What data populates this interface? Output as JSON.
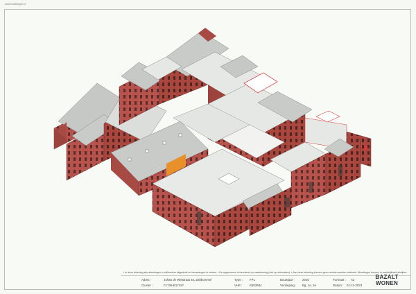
{
  "header": {
    "file_label": "www.bulkfogel.nl"
  },
  "notice": "• In deze tekening zijn afmetingen in millimeters uitgedrukt en benamingen in meters. • De opgenomen is berekend op maatvoering (niet op stukmaten). • Aan deze tekening kunnen geen rechten worden ontleend. Afmetingen kunnen in werkelijkheid afwijken.",
  "titleblock": {
    "adres_label": "Adres :",
    "adres_value": "Johan de Wittstraat 26, Zaltbommel",
    "cluster_label": "Cluster :",
    "cluster_value": "F1726-B17427",
    "type_label": "Type :",
    "type_value": "FPL",
    "vhe_label": "VHE :",
    "vhe_value": "E503934",
    "bouwjaar_label": "Bouwjaar :",
    "bouwjaar_value": "2010",
    "verdieping_label": "Verdieping :",
    "verdieping_value": "Bg, 1e, 2e",
    "formaat_label": "Formaat :",
    "formaat_value": "A3",
    "datum_label": "Datum :",
    "datum_value": "01-11-2023"
  },
  "logo": {
    "line1": "BAZALT",
    "line2": "WONEN"
  },
  "colors": {
    "brick": "#b8524c",
    "brick_dark": "#8e3d39",
    "roof": "#c9cbc8",
    "roof_flat": "#e6e8e5",
    "accent_orange": "#e8912a",
    "accent_red": "#d63a3a"
  }
}
